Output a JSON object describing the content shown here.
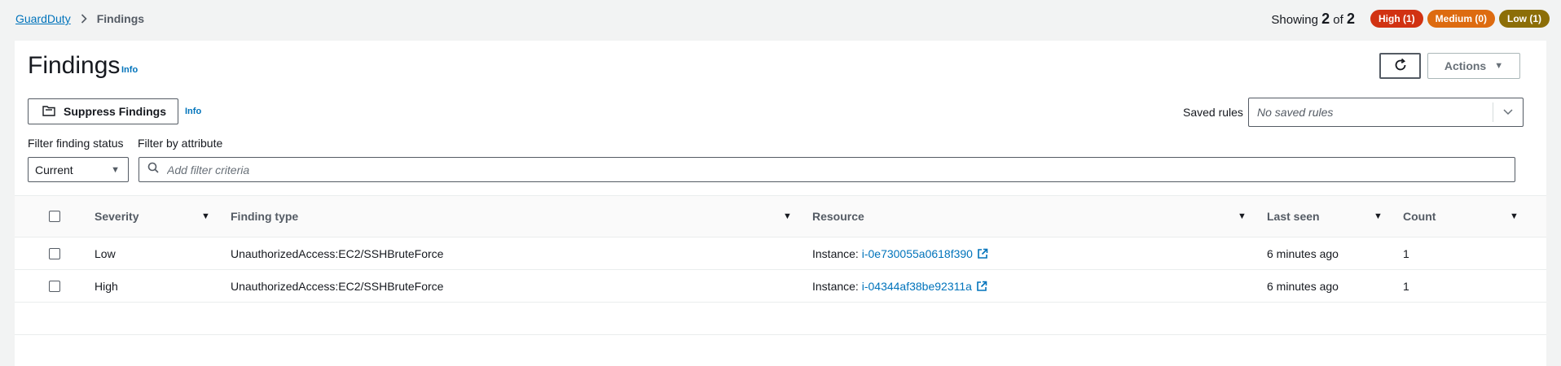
{
  "breadcrumb": {
    "root": "GuardDuty",
    "current": "Findings"
  },
  "summary": {
    "prefix": "Showing",
    "shown": "2",
    "of": "of",
    "total": "2",
    "badges": {
      "high": "High (1)",
      "medium": "Medium (0)",
      "low": "Low (1)"
    }
  },
  "header": {
    "title": "Findings",
    "info": "Info",
    "actions_label": "Actions"
  },
  "toolbar": {
    "suppress_label": "Suppress Findings",
    "suppress_info": "Info",
    "saved_rules_label": "Saved rules",
    "saved_rules_value": "No saved rules"
  },
  "filters": {
    "status_label": "Filter finding status",
    "status_value": "Current",
    "attribute_label": "Filter by attribute",
    "attribute_placeholder": "Add filter criteria"
  },
  "table": {
    "columns": {
      "severity": "Severity",
      "finding_type": "Finding type",
      "resource": "Resource",
      "last_seen": "Last seen",
      "count": "Count"
    },
    "rows": [
      {
        "severity": "Low",
        "finding_type": "UnauthorizedAccess:EC2/SSHBruteForce",
        "resource_prefix": "Instance:",
        "resource_id": "i-0e730055a0618f390",
        "last_seen": "6 minutes ago",
        "count": "1"
      },
      {
        "severity": "High",
        "finding_type": "UnauthorizedAccess:EC2/SSHBruteForce",
        "resource_prefix": "Instance:",
        "resource_id": "i-04344af38be92311a",
        "last_seen": "6 minutes ago",
        "count": "1"
      }
    ]
  },
  "colors": {
    "link": "#0073bb",
    "high": "#d13212",
    "medium": "#dd6b10",
    "low": "#8c6e08"
  }
}
